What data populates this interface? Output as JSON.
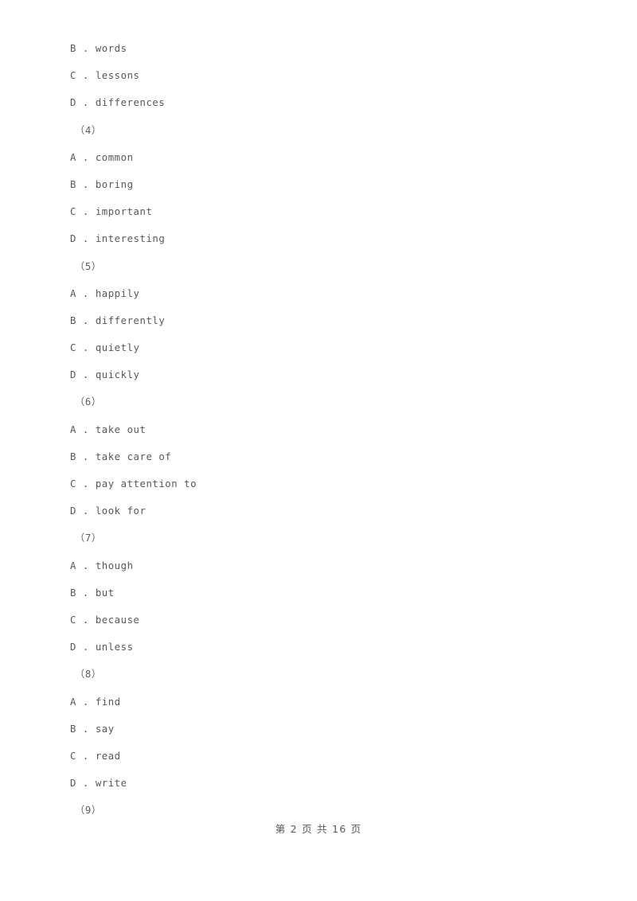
{
  "document": {
    "page_background": "#ffffff",
    "text_color": "#58585a",
    "lines": [
      {
        "kind": "option",
        "text": "B . words"
      },
      {
        "kind": "option",
        "text": "C . lessons"
      },
      {
        "kind": "option",
        "text": "D . differences"
      },
      {
        "kind": "qnum",
        "text": "（4）"
      },
      {
        "kind": "option",
        "text": "A . common"
      },
      {
        "kind": "option",
        "text": "B . boring"
      },
      {
        "kind": "option",
        "text": "C . important"
      },
      {
        "kind": "option",
        "text": "D . interesting"
      },
      {
        "kind": "qnum",
        "text": "（5）"
      },
      {
        "kind": "option",
        "text": "A . happily"
      },
      {
        "kind": "option",
        "text": "B . differently"
      },
      {
        "kind": "option",
        "text": "C . quietly"
      },
      {
        "kind": "option",
        "text": "D . quickly"
      },
      {
        "kind": "qnum",
        "text": "（6）"
      },
      {
        "kind": "option",
        "text": "A . take out"
      },
      {
        "kind": "option",
        "text": "B . take care of"
      },
      {
        "kind": "option",
        "text": "C . pay attention to"
      },
      {
        "kind": "option",
        "text": "D . look for"
      },
      {
        "kind": "qnum",
        "text": "（7）"
      },
      {
        "kind": "option",
        "text": "A . though"
      },
      {
        "kind": "option",
        "text": "B . but"
      },
      {
        "kind": "option",
        "text": "C . because"
      },
      {
        "kind": "option",
        "text": "D . unless"
      },
      {
        "kind": "qnum",
        "text": "（8）"
      },
      {
        "kind": "option",
        "text": "A . find"
      },
      {
        "kind": "option",
        "text": "B . say"
      },
      {
        "kind": "option",
        "text": "C . read"
      },
      {
        "kind": "option",
        "text": "D . write"
      },
      {
        "kind": "qnum",
        "text": "（9）"
      }
    ]
  },
  "footer": {
    "text": "第 2 页 共 16 页",
    "current_page": "2",
    "total_pages": "16"
  }
}
